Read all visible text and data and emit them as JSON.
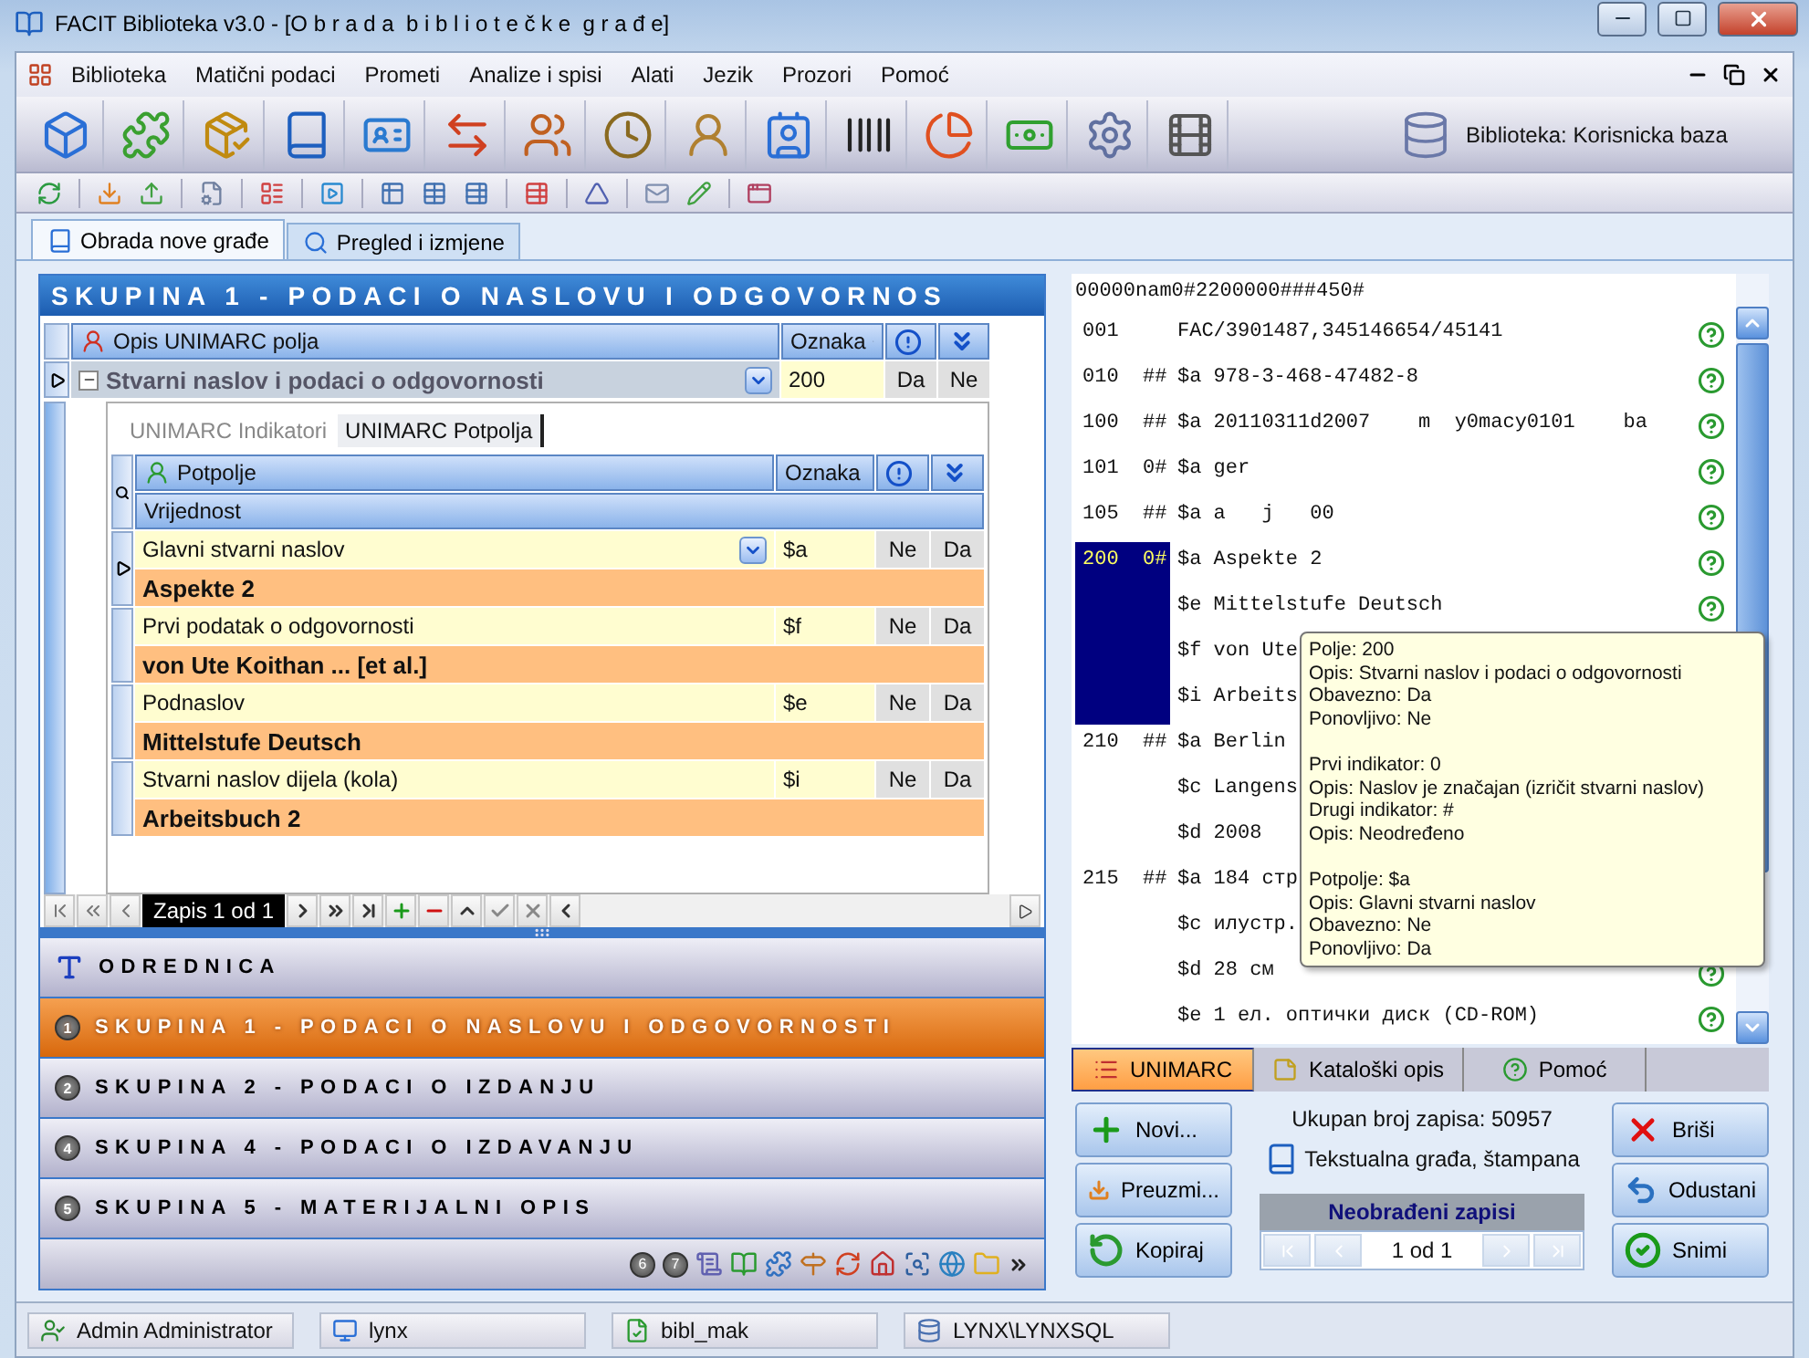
{
  "window": {
    "title": "FACIT Biblioteka v3.0 - [O b r a d a  b i b l i o t e č k e  g r a đ e]"
  },
  "menu": [
    "Biblioteka",
    "Matični podaci",
    "Prometi",
    "Analize i spisi",
    "Alati",
    "Jezik",
    "Prozori",
    "Pomoć"
  ],
  "toolbar": {
    "library": "Biblioteka: Korisnicka baza"
  },
  "tabs": [
    {
      "label": "Obrada nove građe",
      "selected": true
    },
    {
      "label": "Pregled i izmjene",
      "selected": false
    }
  ],
  "group_panel": {
    "title": "SKUPINA 1 - PODACI O NASLOVU I ODGOVORNOS",
    "columns": [
      "Opis UNIMARC polja",
      "Oznaka"
    ],
    "row": {
      "name": "Stvarni naslov i podaci o odgovornosti",
      "tag": "200",
      "mandatory": "Da",
      "repeatable": "Ne",
      "expanded": true
    },
    "detail_tabs": [
      {
        "label": "UNIMARC Indikatori",
        "selected": false
      },
      {
        "label": "UNIMARC Potpolja",
        "selected": true
      }
    ],
    "sub_columns": [
      "Potpolje",
      "Oznaka"
    ],
    "value_column": "Vrijednost",
    "subfields": [
      {
        "name": "Glavni stvarni naslov",
        "code": "$a",
        "mandatory": "Ne",
        "repeatable": "Da",
        "value": "Aspekte 2",
        "selected": true
      },
      {
        "name": "Prvi podatak o odgovornosti",
        "code": "$f",
        "mandatory": "Ne",
        "repeatable": "Da",
        "value": "von Ute Koithan ... [et al.]",
        "selected": false
      },
      {
        "name": "Podnaslov",
        "code": "$e",
        "mandatory": "Ne",
        "repeatable": "Da",
        "value": "Mittelstufe Deutsch",
        "selected": false
      },
      {
        "name": "Stvarni naslov dijela (kola)",
        "code": "$i",
        "mandatory": "Ne",
        "repeatable": "Da",
        "value": "Arbeitsbuch 2",
        "selected": false
      }
    ],
    "navigator": "Zapis 1 od 1"
  },
  "sections": [
    {
      "kind": "heading",
      "label": "ODREDNICA",
      "selected": false
    },
    {
      "kind": "group",
      "number": "1",
      "label": "SKUPINA 1 - PODACI O NASLOVU I ODGOVORNOSTI",
      "selected": true
    },
    {
      "kind": "group",
      "number": "2",
      "label": "SKUPINA 2 - PODACI O IZDANJU",
      "selected": false
    },
    {
      "kind": "group",
      "number": "4",
      "label": "SKUPINA 4 - PODACI O IZDAVANJU",
      "selected": false
    },
    {
      "kind": "group",
      "number": "5",
      "label": "SKUPINA 5 - MATERIJALNI OPIS",
      "selected": false
    }
  ],
  "more_groups": [
    "6",
    "7"
  ],
  "record": {
    "leader": "00000nam0#2200000###450#",
    "fields": [
      {
        "tag": "001",
        "lines": [
          "FAC/3901487,345146654/45141"
        ],
        "selected": false
      },
      {
        "tag": "010",
        "ind": "##",
        "lines": [
          "$a 978-3-468-47482-8"
        ],
        "selected": false
      },
      {
        "tag": "100",
        "ind": "##",
        "lines": [
          "$a 20110311d2007    m  y0macy0101    ba"
        ],
        "selected": false
      },
      {
        "tag": "101",
        "ind": "0#",
        "lines": [
          "$a ger"
        ],
        "selected": false
      },
      {
        "tag": "105",
        "ind": "##",
        "lines": [
          "$a a   j   00"
        ],
        "selected": false
      },
      {
        "tag": "200",
        "ind": "0#",
        "lines": [
          "$a Aspekte 2",
          "$e Mittelstufe Deutsch",
          "$f von Ute",
          "$i Arbeits"
        ],
        "selected": true
      },
      {
        "tag": "210",
        "ind": "##",
        "lines": [
          "$a Berlin",
          "$c Langens",
          "$d 2008"
        ],
        "selected": false
      },
      {
        "tag": "215",
        "ind": "##",
        "lines": [
          "$a 184 стр",
          "$c илустр.",
          "$d 28 см",
          "$e 1 ел. оптички диск (CD-ROM)"
        ],
        "selected": false
      }
    ]
  },
  "tooltip": [
    [
      "Polje: 200",
      "Opis: Stvarni naslov i podaci o odgovornosti",
      "Obavezno: Da",
      "Ponovljivo: Ne"
    ],
    [
      "Prvi indikator: 0",
      "Opis: Naslov je značajan (izričit stvarni naslov)",
      "Drugi indikator: #",
      "Opis: Neodređeno"
    ],
    [
      "Potpolje: $a",
      "Opis: Glavni stvarni naslov",
      "Obavezno: Ne",
      "Ponovljivo: Da"
    ]
  ],
  "view_tabs": [
    {
      "kind": "unimarc",
      "label": "UNIMARC",
      "selected": true
    },
    {
      "kind": "catalog",
      "label": "Kataloški opis",
      "selected": false
    },
    {
      "kind": "help",
      "label": "Pomoć",
      "selected": false
    }
  ],
  "left_buttons": [
    {
      "kind": "new",
      "label": "Novi..."
    },
    {
      "kind": "import",
      "label": "Preuzmi..."
    },
    {
      "kind": "copy",
      "label": "Kopiraj"
    }
  ],
  "summary": {
    "total": "Ukupan broj zapisa: 50957",
    "material": "Tekstualna građa, štampana",
    "queue": "Neobrađeni zapisi",
    "pager": "1 od 1"
  },
  "right_buttons": [
    {
      "kind": "delete",
      "label": "Briši"
    },
    {
      "kind": "cancel",
      "label": "Odustani"
    },
    {
      "kind": "save",
      "label": "Snimi"
    }
  ],
  "status_bar": [
    {
      "kind": "user",
      "label": "Admin Administrator"
    },
    {
      "kind": "host",
      "label": "lynx"
    },
    {
      "kind": "db",
      "label": "bibl_mak"
    },
    {
      "kind": "server",
      "label": "LYNX\\LYNXSQL"
    }
  ]
}
